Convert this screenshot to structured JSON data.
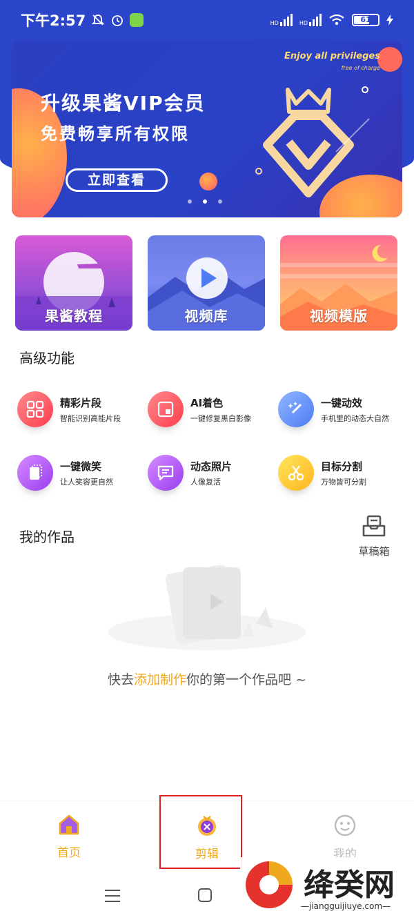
{
  "status_bar": {
    "time": "下午2:57",
    "battery": "61",
    "signal1": "HD",
    "signal2": "HD"
  },
  "banner": {
    "title": "升级果酱VIP会员",
    "subtitle": "免费畅享所有权限",
    "button_label": "立即查看",
    "english_title": "Enjoy all privileges",
    "english_sub": "free of charge",
    "page_count": 3,
    "active_page": 2
  },
  "cards": [
    {
      "label": "果酱教程"
    },
    {
      "label": "视频库"
    },
    {
      "label": "视频模版"
    }
  ],
  "features_section": {
    "title": "高级功能",
    "items": [
      {
        "title": "精彩片段",
        "desc": "智能识别高能片段",
        "icon": "grid-icon",
        "color": "red"
      },
      {
        "title": "AI着色",
        "desc": "一键修复黑白影像",
        "icon": "photo-frame-icon",
        "color": "red"
      },
      {
        "title": "一键动效",
        "desc": "手机里的动态大自然",
        "icon": "magic-wand-icon",
        "color": "blue"
      },
      {
        "title": "一键微笑",
        "desc": "让人笑容更自然",
        "icon": "cards-icon",
        "color": "purple"
      },
      {
        "title": "动态照片",
        "desc": "人像复活",
        "icon": "message-icon",
        "color": "purple"
      },
      {
        "title": "目标分割",
        "desc": "万物皆可分割",
        "icon": "scissors-icon",
        "color": "yellow"
      }
    ]
  },
  "works_section": {
    "title": "我的作品",
    "drafts_label": "草稿箱",
    "empty_prefix": "快去",
    "empty_link": "添加制作",
    "empty_suffix": "你的第一个作品吧 ~"
  },
  "tabbar": {
    "home": "首页",
    "edit": "剪辑",
    "mine": "我的",
    "active_color": "#f0a81e"
  },
  "watermark": {
    "title": "绛癸网",
    "url": "—jiangguijiuye.com—"
  }
}
